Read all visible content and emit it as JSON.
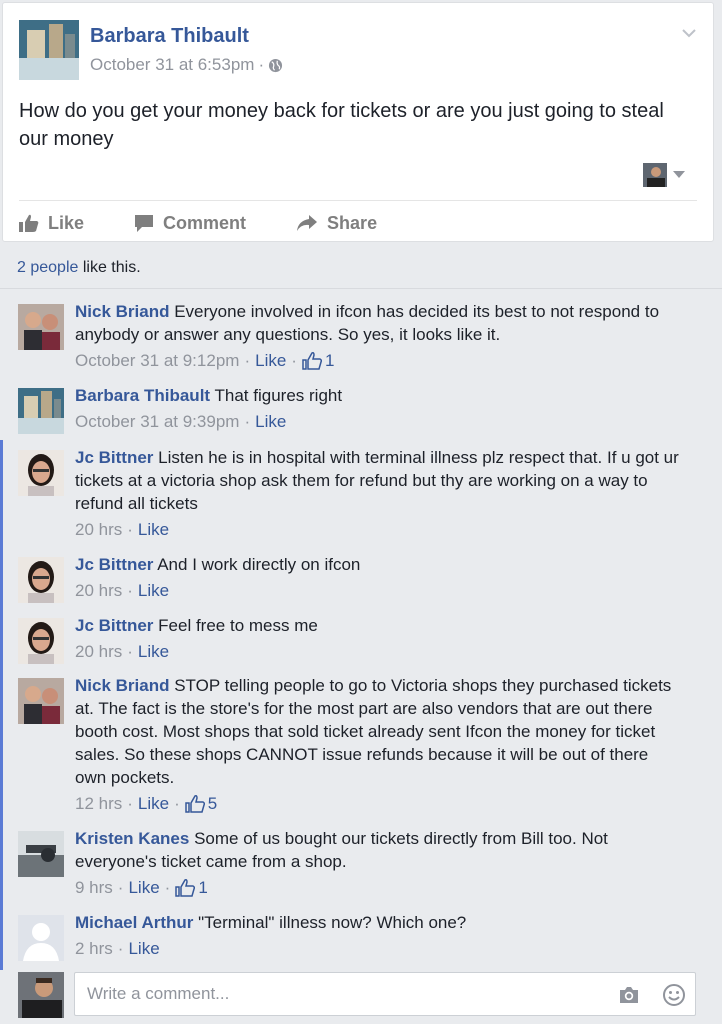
{
  "post": {
    "author": "Barbara Thibault",
    "time": "October 31 at 6:53pm",
    "meta_dot": "·",
    "text": "How do you get your money back for tickets or are you just going to steal our money",
    "actions": {
      "like": "Like",
      "comment": "Comment",
      "share": "Share"
    }
  },
  "likes": {
    "count_link": "2 people",
    "suffix": " like this."
  },
  "comments": [
    {
      "name": "Nick Briand",
      "text": "Everyone involved in ifcon has decided its best to not respond to anybody or answer any questions. So yes, it looks like it.",
      "time": "October 31 at 9:12pm",
      "like": "Like",
      "likes": "1"
    },
    {
      "name": "Barbara Thibault",
      "text": "That figures right",
      "time": "October 31 at 9:39pm",
      "like": "Like"
    },
    {
      "name": "Jc Bittner",
      "text": "Listen he is in hospital with terminal illness plz respect that. If u got ur tickets at a victoria shop ask them for refund but thy are working on a way to refund all tickets",
      "time": "20 hrs",
      "like": "Like"
    },
    {
      "name": "Jc Bittner",
      "text": "And I work directly on ifcon",
      "time": "20 hrs",
      "like": "Like"
    },
    {
      "name": "Jc Bittner",
      "text": "Feel free to mess me",
      "time": "20 hrs",
      "like": "Like"
    },
    {
      "name": "Nick Briand",
      "text": "STOP telling people to go to Victoria shops they purchased tickets at. The fact is the store's for the most part are also vendors that are out there booth cost. Most shops that sold ticket already sent Ifcon the money for ticket sales. So these shops CANNOT issue refunds because it will be out of there own pockets.",
      "time": "12 hrs",
      "like": "Like",
      "likes": "5"
    },
    {
      "name": "Kristen Kanes",
      "text": "Some of us bought our tickets directly from Bill too. Not everyone's ticket came from a shop.",
      "time": "9 hrs",
      "like": "Like",
      "likes": "1"
    },
    {
      "name": "Michael Arthur",
      "text": "\"Terminal\" illness now? Which one?",
      "time": "2 hrs",
      "like": "Like"
    }
  ],
  "composer": {
    "placeholder": "Write a comment..."
  },
  "colors": {
    "link": "#365899",
    "meta": "#90949c",
    "background": "#e9ebee",
    "accent": "#5b7bd5"
  },
  "icons": [
    "chevron-down-icon",
    "globe-icon",
    "like-icon",
    "comment-icon",
    "share-icon",
    "thumbs-up-icon",
    "camera-icon",
    "smiley-icon"
  ]
}
